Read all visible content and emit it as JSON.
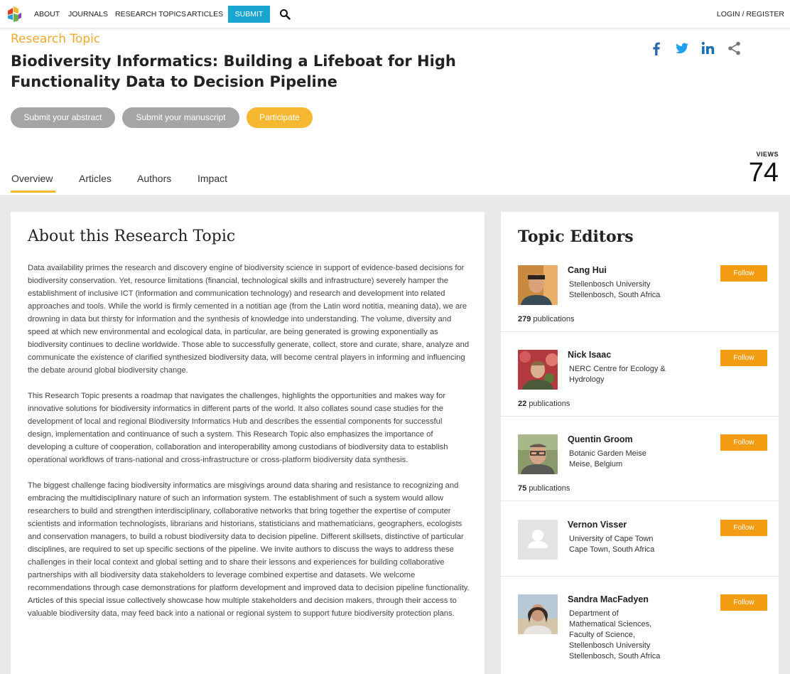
{
  "nav": {
    "items": [
      "ABOUT",
      "JOURNALS",
      "RESEARCH TOPICS",
      "ARTICLES"
    ],
    "submit": "SUBMIT",
    "login": "LOGIN / REGISTER"
  },
  "header": {
    "label": "Research Topic",
    "title": "Biodiversity Informatics: Building a Lifeboat for High Functionality Data to Decision Pipeline",
    "buttons": {
      "abstract": "Submit your abstract",
      "manuscript": "Submit your manuscript",
      "participate": "Participate"
    },
    "views_label": "VIEWS",
    "views_count": "74"
  },
  "tabs": [
    "Overview",
    "Articles",
    "Authors",
    "Impact"
  ],
  "about": {
    "title": "About this Research Topic",
    "paragraphs": [
      "Data availability primes the research and discovery engine of biodiversity science in support of evidence-based decisions for biodiversity conservation. Yet, resource limitations (financial, technological skills and infrastructure) severely hamper the establishment of inclusive ICT (information and communication technology) and research and development into related approaches and tools. While the world is firmly cemented in a notitian age (from the Latin word notitia, meaning data), we are drowning in data but thirsty for information and the synthesis of knowledge into understanding. The volume, diversity and speed at which new environmental and ecological data, in particular, are being generated is growing exponentially as biodiversity continues to decline worldwide. Those able to successfully generate, collect, store and curate, share, analyze and communicate the existence of clarified synthesized biodiversity data, will become central players in informing and influencing the debate around global biodiversity change.",
      "This Research Topic presents a roadmap that navigates the challenges, highlights the opportunities and makes way for innovative solutions for biodiversity informatics in different parts of the world. It also collates sound case studies for the development of local and regional Biodiversity Informatics Hub and describes the essential components for successful design, implementation and continuance of such a system. This Research Topic also emphasizes the importance of developing a culture of cooperation, collaboration and interoperability among custodians of biodiversity data to establish operational workflows of trans-national and cross-infrastructure or cross-platform biodiversity data synthesis.",
      "The biggest challenge facing biodiversity informatics are misgivings around data sharing and resistance to recognizing and embracing the multidisciplinary nature of such an information system. The establishment of such a system would allow researchers to build and strengthen interdisciplinary, collaborative networks that bring together the expertise of computer scientists and information technologists, librarians and historians, statisticians and mathematicians, geographers, ecologists and conservation managers, to build a robust biodiversity data to decision pipeline. Different skillsets, distinctive of particular disciplines, are required to set up specific sections of the pipeline. We invite authors to discuss the ways to address these challenges in their local context and global setting and to share their lessons and experiences for building collaborative partnerships with all biodiversity data stakeholders to leverage combined expertise and datasets. We welcome recommendations through case demonstrations for platform development and improved data to decision pipeline functionality. Articles of this special issue collectively showcase how multiple stakeholders and decision makers, through their access to valuable biodiversity data, may feed back into a national or regional system to support future biodiversity protection plans."
    ]
  },
  "editors": {
    "title": "Topic Editors",
    "follow_label": "Follow",
    "publications_suffix": "publications",
    "people": [
      {
        "name": "Cang Hui",
        "aff": [
          "Stellenbosch University",
          "Stellenbosch, South Africa"
        ],
        "pubs": "279"
      },
      {
        "name": "Nick Isaac",
        "aff": [
          "NERC Centre for Ecology &",
          "Hydrology"
        ],
        "pubs": "22"
      },
      {
        "name": "Quentin Groom",
        "aff": [
          "Botanic Garden Meise",
          "Meise, Belgium"
        ],
        "pubs": "75"
      },
      {
        "name": "Vernon Visser",
        "aff": [
          "University of Cape Town",
          "Cape Town, South Africa"
        ],
        "pubs": ""
      },
      {
        "name": "Sandra MacFadyen",
        "aff": [
          "Department of",
          "Mathematical Sciences,",
          "Faculty of Science,",
          "Stellenbosch University",
          "Stellenbosch, South Africa"
        ],
        "pubs": ""
      }
    ]
  },
  "colors": {
    "accent_yellow": "#f5b830",
    "follow_orange": "#f39c12",
    "submit_blue": "#1aa5d0"
  }
}
